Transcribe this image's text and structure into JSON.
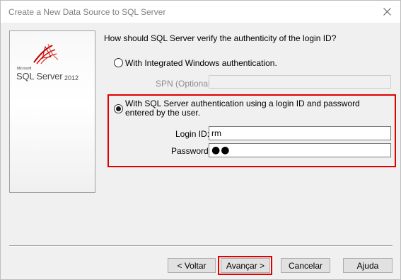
{
  "window": {
    "title": "Create a New Data Source to SQL Server"
  },
  "branding": {
    "logo_microsoft": "Microsoft",
    "logo_product": "SQL Server",
    "logo_version": "2012"
  },
  "form": {
    "question": "How should SQL Server verify the authenticity of the login ID?",
    "auth_integrated_label": "With Integrated Windows authentication.",
    "spn_label": "SPN (Optional):",
    "spn_value": "",
    "auth_sql_label": "With SQL Server authentication using a login ID and password entered by the user.",
    "login_label": "Login ID:",
    "login_value": "rm",
    "password_label": "Password:",
    "password_value": "●●",
    "selected_auth": "sql"
  },
  "buttons": {
    "back": "< Voltar",
    "next": "Avançar >",
    "cancel": "Cancelar",
    "help": "Ajuda"
  },
  "colors": {
    "highlight": "#e00000",
    "dialog_bg": "#f0f0f0"
  }
}
